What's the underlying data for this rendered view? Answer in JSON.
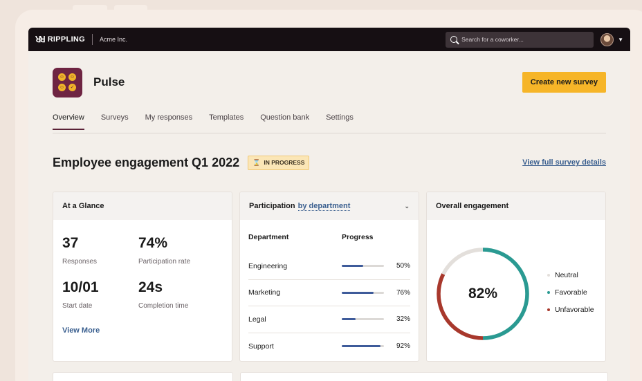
{
  "topbar": {
    "brand": "RIPPLING",
    "company": "Acme Inc.",
    "search_placeholder": "Search for a coworker..."
  },
  "header": {
    "app_name": "Pulse",
    "create_button": "Create new survey"
  },
  "tabs": [
    {
      "label": "Overview",
      "active": true
    },
    {
      "label": "Surveys"
    },
    {
      "label": "My responses"
    },
    {
      "label": "Templates"
    },
    {
      "label": "Question bank"
    },
    {
      "label": "Settings"
    }
  ],
  "survey": {
    "title": "Employee engagement Q1 2022",
    "status": "IN PROGRESS",
    "details_link": "View full survey details"
  },
  "glance": {
    "title": "At a Glance",
    "metrics": [
      {
        "value": "37",
        "label": "Responses"
      },
      {
        "value": "74%",
        "label": "Participation rate"
      },
      {
        "value": "10/01",
        "label": "Start date"
      },
      {
        "value": "24s",
        "label": "Completion time"
      }
    ],
    "view_more": "View More"
  },
  "participation": {
    "title": "Participation",
    "filter": "by department",
    "col_department": "Department",
    "col_progress": "Progress",
    "rows": [
      {
        "department": "Engineering",
        "percent": "50%",
        "value": 0.5
      },
      {
        "department": "Marketing",
        "percent": "76%",
        "value": 0.76
      },
      {
        "department": "Legal",
        "percent": "32%",
        "value": 0.32
      },
      {
        "department": "Support",
        "percent": "92%",
        "value": 0.92
      }
    ]
  },
  "engagement": {
    "title": "Overall engagement",
    "score": "82%",
    "legend": [
      {
        "label": "Neutral",
        "color": "#e3dfdb"
      },
      {
        "label": "Favorable",
        "color": "#2a9a92"
      },
      {
        "label": "Unfavorable",
        "color": "#a8382c"
      }
    ]
  },
  "colors": {
    "accent": "#f6b528",
    "brand": "#6e2442",
    "link": "#3a5f8f",
    "progress": "#3e5b9a"
  }
}
